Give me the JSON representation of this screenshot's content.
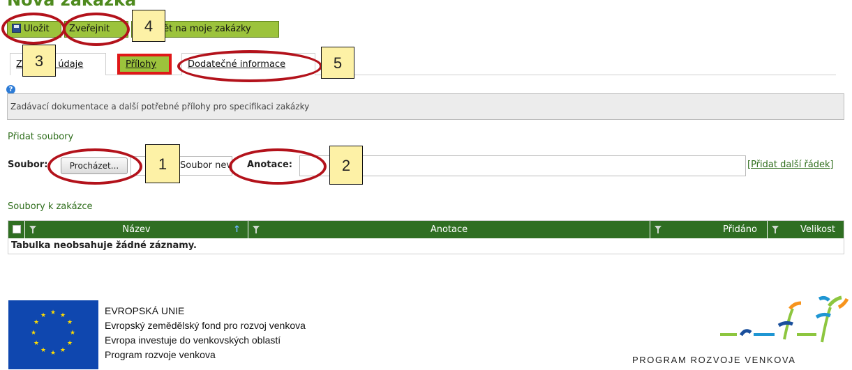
{
  "toolbar": {
    "save_label": "Uložit",
    "publish_label": "Zveřejnit",
    "back_label": "Zpět na moje zakázky"
  },
  "tabs": [
    {
      "label": "Základní údaje"
    },
    {
      "label": "Přílohy",
      "active": true
    },
    {
      "label": "Dodatečné informace"
    }
  ],
  "info": {
    "text": "Zadávací dokumentace a další potřebné přílohy pro specifikaci zakázky"
  },
  "add_files": {
    "title": "Přidat soubory",
    "file_label": "Soubor:",
    "browse_label": "Procházet...",
    "no_file_text": "Soubor nevybrán",
    "annotation_label": "Anotace:",
    "annotation_value": "",
    "add_row_label": "[Přidat další řádek]"
  },
  "files_table": {
    "title": "Soubory k zakázce",
    "columns": [
      "Název",
      "Anotace",
      "Přidáno",
      "Velikost"
    ],
    "empty_text": "Tabulka neobsahuje žádné záznamy."
  },
  "footer": {
    "eu_lines": [
      "EVROPSKÁ UNIE",
      "Evropský zemědělský fond pro rozvoj venkova",
      "Evropa investuje do venkovských oblastí",
      "Program rozvoje venkova"
    ],
    "prv_caption": "PROGRAM ROZVOJE VENKOVA"
  },
  "annotations": [
    "1",
    "2",
    "3",
    "4",
    "5"
  ],
  "colors": {
    "button_green": "#9cc33c",
    "table_header": "#2f6e22",
    "marker_red": "#b3121b",
    "callout_yellow": "#fdf1a6"
  },
  "icons": [
    "save-icon",
    "help-icon",
    "filter-icon",
    "sort-up-icon",
    "checkbox-icon"
  ]
}
